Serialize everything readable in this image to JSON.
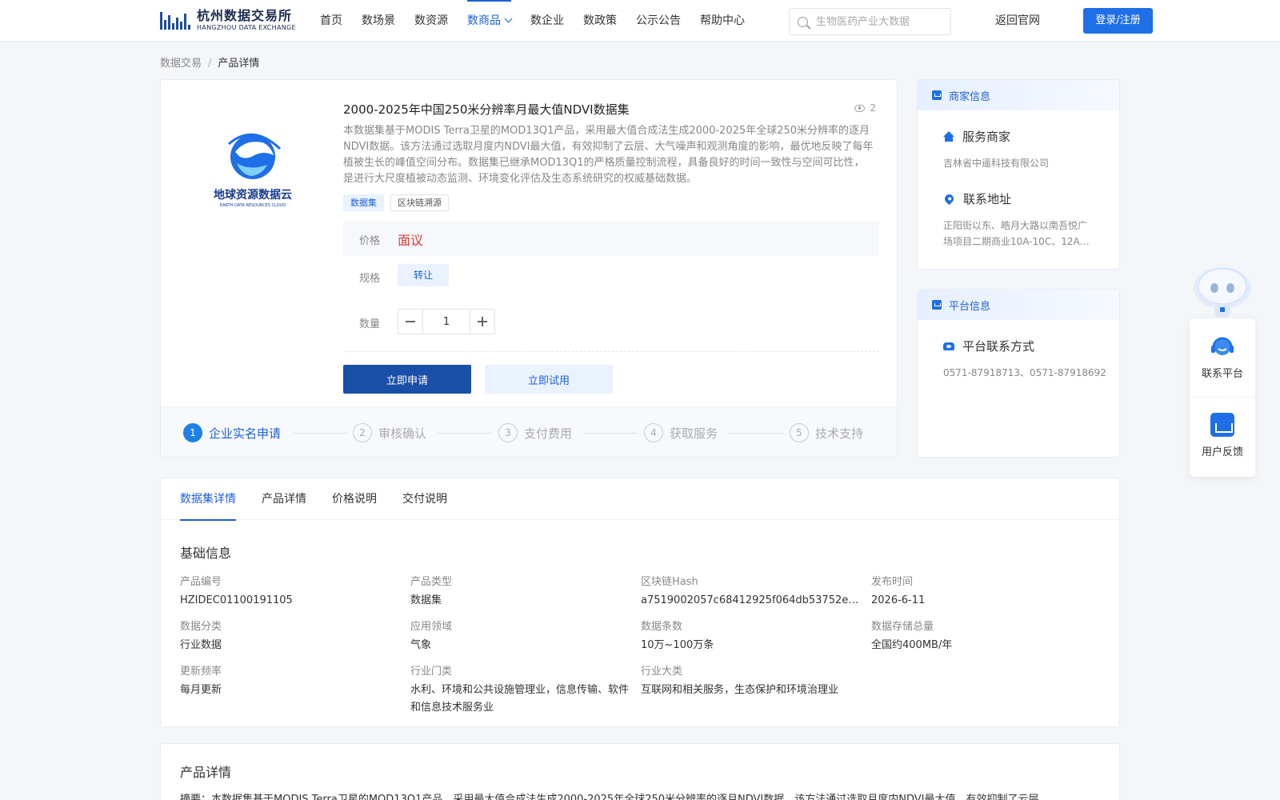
{
  "header": {
    "logo_cn": "杭州数据交易所",
    "logo_en": "HANGZHOU DATA EXCHANGE",
    "nav": [
      "首页",
      "数场景",
      "数资源",
      "数商品",
      "数企业",
      "数政策",
      "公示公告",
      "帮助中心"
    ],
    "nav_active": "数商品",
    "search_placeholder": "生物医药产业大数据",
    "back_link": "返回官网",
    "login_label": "登录/注册"
  },
  "breadcrumb": {
    "root": "数据交易",
    "sep": "/",
    "current": "产品详情"
  },
  "product": {
    "logo_text": "地球资源数据云",
    "logo_sub": "EARTH DATA RESOURCES CLOUD",
    "title": "2000-2025年中国250米分辨率月最大值NDVI数据集",
    "views": "2",
    "description": "本数据集基于MODIS Terra卫星的MOD13Q1产品，采用最大值合成法生成2000-2025年全球250米分辨率的逐月NDVI数据。该方法通过选取月度内NDVI最大值，有效抑制了云层、大气噪声和观测角度的影响，最优地反映了每年植被生长的峰值空间分布。数据集已继承MOD13Q1的严格质量控制流程，具备良好的时间一致性与空间可比性，是进行大尺度植被动态监测、环境变化评估及生态系统研究的权威基础数据。",
    "tags": [
      "数据集",
      "区块链溯源"
    ],
    "price_label": "价格",
    "price_value": "面议",
    "spec_label": "规格",
    "spec_value": "转让",
    "qty_label": "数量",
    "qty_value": "1",
    "apply_label": "立即申请",
    "trial_label": "立即试用",
    "steps": [
      {
        "num": "1",
        "label": "企业实名申请"
      },
      {
        "num": "2",
        "label": "审核确认"
      },
      {
        "num": "3",
        "label": "支付费用"
      },
      {
        "num": "4",
        "label": "获取服务"
      },
      {
        "num": "5",
        "label": "技术支持"
      }
    ]
  },
  "merchant": {
    "header": "商家信息",
    "service_title": "服务商家",
    "service_value": "吉林省中遥科技有限公司",
    "address_title": "联系地址",
    "address_value": "正阳街以东、皓月大路以南吾悦广场项目二期商业10A-10C、12A…"
  },
  "platform": {
    "header": "平台信息",
    "contact_title": "平台联系方式",
    "contact_value": "0571-87918713、0571-87918692"
  },
  "float_panel": {
    "contact_label": "联系平台",
    "feedback_label": "用户反馈"
  },
  "details": {
    "tabs": [
      "数据集详情",
      "产品详情",
      "价格说明",
      "交付说明"
    ],
    "section_title": "基础信息",
    "fields": [
      {
        "label": "产品编号",
        "value": "HZIDEC01100191105"
      },
      {
        "label": "产品类型",
        "value": "数据集"
      },
      {
        "label": "区块链Hash",
        "value": "a7519002057c68412925f064db53752ed6…"
      },
      {
        "label": "发布时间",
        "value": "2026-6-11"
      },
      {
        "label": "数据分类",
        "value": "行业数据"
      },
      {
        "label": "应用领域",
        "value": "气象"
      },
      {
        "label": "数据条数",
        "value": "10万~100万条"
      },
      {
        "label": "数据存储总量",
        "value": "全国约400MB/年"
      },
      {
        "label": "更新频率",
        "value": "每月更新"
      },
      {
        "label": "行业门类",
        "value": "水利、环境和公共设施管理业，信息传输、软件和信息技术服务业"
      },
      {
        "label": "行业大类",
        "value": "互联网和相关服务，生态保护和环境治理业"
      }
    ]
  },
  "product_detail": {
    "title": "产品详情",
    "text": "摘要：本数据集基于MODIS Terra卫星的MOD13Q1产品，采用最大值合成法生成2000-2025年全球250米分辨率的逐月NDVI数据。该方法通过选取月度内NDVI最大值，有效抑制了云层"
  },
  "colors": {
    "accent": "#1f5fd8",
    "price": "#e03b30",
    "primary_button": "#1a4fa8"
  }
}
